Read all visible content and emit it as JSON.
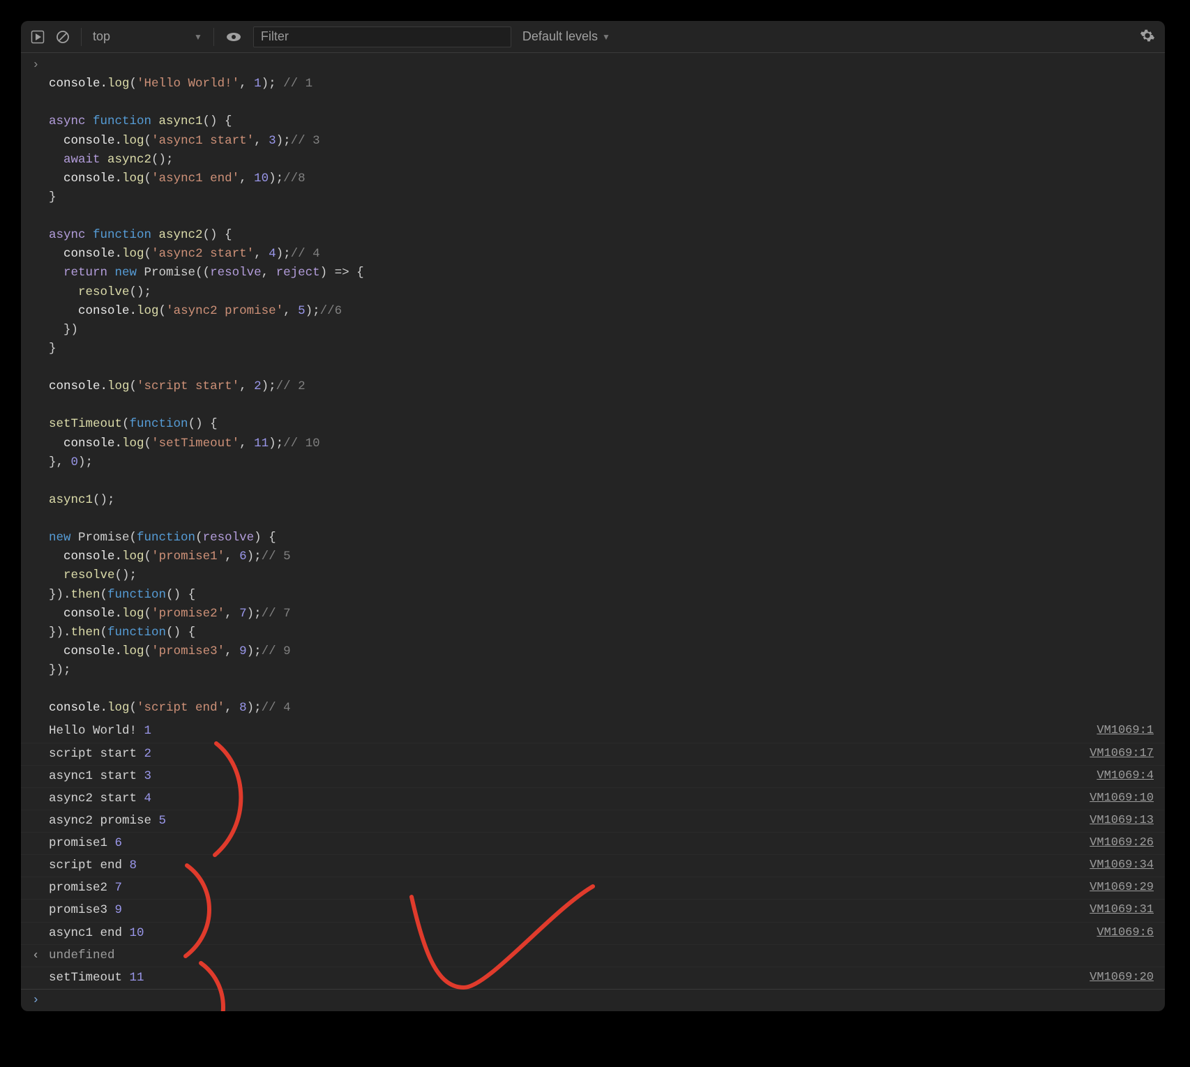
{
  "toolbar": {
    "context": "top",
    "filter_placeholder": "Filter",
    "levels": "Default levels"
  },
  "gutters": {
    "expand": "›",
    "return": "‹",
    "prompt": "›"
  },
  "code": {
    "l1": {
      "a": "console.",
      "b": "log",
      "c": "(",
      "d": "'Hello World!'",
      "e": ", ",
      "f": "1",
      "g": "); ",
      "h": "// 1"
    },
    "l2": {
      "a": "async ",
      "b": "function ",
      "c": "async1",
      "d": "() {"
    },
    "l3": {
      "a": "  console.",
      "b": "log",
      "c": "(",
      "d": "'async1 start'",
      "e": ", ",
      "f": "3",
      "g": ");",
      "h": "// 3"
    },
    "l4": {
      "a": "  ",
      "b": "await ",
      "c": "async2",
      "d": "();"
    },
    "l5": {
      "a": "  console.",
      "b": "log",
      "c": "(",
      "d": "'async1 end'",
      "e": ", ",
      "f": "10",
      "g": ");",
      "h": "//8"
    },
    "l6": {
      "a": "}"
    },
    "l7": {
      "a": "async ",
      "b": "function ",
      "c": "async2",
      "d": "() {"
    },
    "l8": {
      "a": "  console.",
      "b": "log",
      "c": "(",
      "d": "'async2 start'",
      "e": ", ",
      "f": "4",
      "g": ");",
      "h": "// 4"
    },
    "l9": {
      "a": "  ",
      "b": "return ",
      "c": "new ",
      "d": "Promise",
      "e": "((",
      "f": "resolve",
      "g": ", ",
      "h": "reject",
      "i": ") => {"
    },
    "l10": {
      "a": "    ",
      "b": "resolve",
      "c": "();"
    },
    "l11": {
      "a": "    console.",
      "b": "log",
      "c": "(",
      "d": "'async2 promise'",
      "e": ", ",
      "f": "5",
      "g": ");",
      "h": "//6"
    },
    "l12": {
      "a": "  })"
    },
    "l13": {
      "a": "}"
    },
    "l14": {
      "a": "console.",
      "b": "log",
      "c": "(",
      "d": "'script start'",
      "e": ", ",
      "f": "2",
      "g": ");",
      "h": "// 2"
    },
    "l15": {
      "a": "setTimeout",
      "b": "(",
      "c": "function",
      "d": "() {"
    },
    "l16": {
      "a": "  console.",
      "b": "log",
      "c": "(",
      "d": "'setTimeout'",
      "e": ", ",
      "f": "11",
      "g": ");",
      "h": "// 10"
    },
    "l17": {
      "a": "}, ",
      "b": "0",
      "c": ");"
    },
    "l18": {
      "a": "async1",
      "b": "();"
    },
    "l19": {
      "a": "new ",
      "b": "Promise",
      "c": "(",
      "d": "function",
      "e": "(",
      "f": "resolve",
      "g": ") {"
    },
    "l20": {
      "a": "  console.",
      "b": "log",
      "c": "(",
      "d": "'promise1'",
      "e": ", ",
      "f": "6",
      "g": ");",
      "h": "// 5"
    },
    "l21": {
      "a": "  ",
      "b": "resolve",
      "c": "();"
    },
    "l22": {
      "a": "}).",
      "b": "then",
      "c": "(",
      "d": "function",
      "e": "() {"
    },
    "l23": {
      "a": "  console.",
      "b": "log",
      "c": "(",
      "d": "'promise2'",
      "e": ", ",
      "f": "7",
      "g": ");",
      "h": "// 7"
    },
    "l24": {
      "a": "}).",
      "b": "then",
      "c": "(",
      "d": "function",
      "e": "() {"
    },
    "l25": {
      "a": "  console.",
      "b": "log",
      "c": "(",
      "d": "'promise3'",
      "e": ", ",
      "f": "9",
      "g": ");",
      "h": "// 9"
    },
    "l26": {
      "a": "});"
    },
    "l27": {
      "a": "console.",
      "b": "log",
      "c": "(",
      "d": "'script end'",
      "e": ", ",
      "f": "8",
      "g": ");",
      "h": "// 4"
    }
  },
  "out": [
    {
      "t": "Hello World! ",
      "n": "1",
      "s": "VM1069:1"
    },
    {
      "t": "script start ",
      "n": "2",
      "s": "VM1069:17"
    },
    {
      "t": "async1 start ",
      "n": "3",
      "s": "VM1069:4"
    },
    {
      "t": "async2 start ",
      "n": "4",
      "s": "VM1069:10"
    },
    {
      "t": "async2 promise ",
      "n": "5",
      "s": "VM1069:13"
    },
    {
      "t": "promise1 ",
      "n": "6",
      "s": "VM1069:26"
    },
    {
      "t": "script end ",
      "n": "8",
      "s": "VM1069:34"
    },
    {
      "t": "promise2 ",
      "n": "7",
      "s": "VM1069:29"
    },
    {
      "t": "promise3 ",
      "n": "9",
      "s": "VM1069:31"
    },
    {
      "t": "async1 end ",
      "n": "10",
      "s": "VM1069:6"
    }
  ],
  "ret": "undefined",
  "out2": {
    "t": "setTimeout ",
    "n": "11",
    "s": "VM1069:20"
  }
}
